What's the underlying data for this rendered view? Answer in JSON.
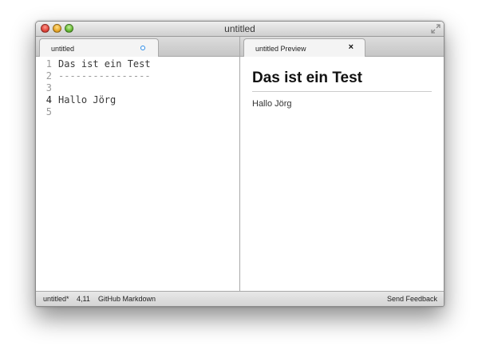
{
  "window": {
    "title": "untitled"
  },
  "tabs": {
    "editor": {
      "label": "untitled"
    },
    "preview": {
      "label": "untitled Preview",
      "close": "×"
    }
  },
  "editor": {
    "line_numbers": [
      "1",
      "2",
      "3",
      "4",
      "5"
    ],
    "lines": [
      "Das ist ein Test",
      "----------------",
      "",
      "Hallo Jörg",
      ""
    ]
  },
  "preview": {
    "heading": "Das ist ein Test",
    "paragraph": "Hallo Jörg"
  },
  "statusbar": {
    "file": "untitled*",
    "position": "4,11",
    "syntax": "GitHub Markdown",
    "feedback": "Send Feedback"
  },
  "colors": {
    "dirty_indicator": "#2b8be6",
    "close_button": "#e0443a",
    "minimize_button": "#e8a628",
    "zoom_button": "#66b934"
  },
  "icons": {
    "fullscreen": "fullscreen-icon",
    "dirty": "dirty-indicator-icon",
    "close_tab": "close-icon"
  }
}
